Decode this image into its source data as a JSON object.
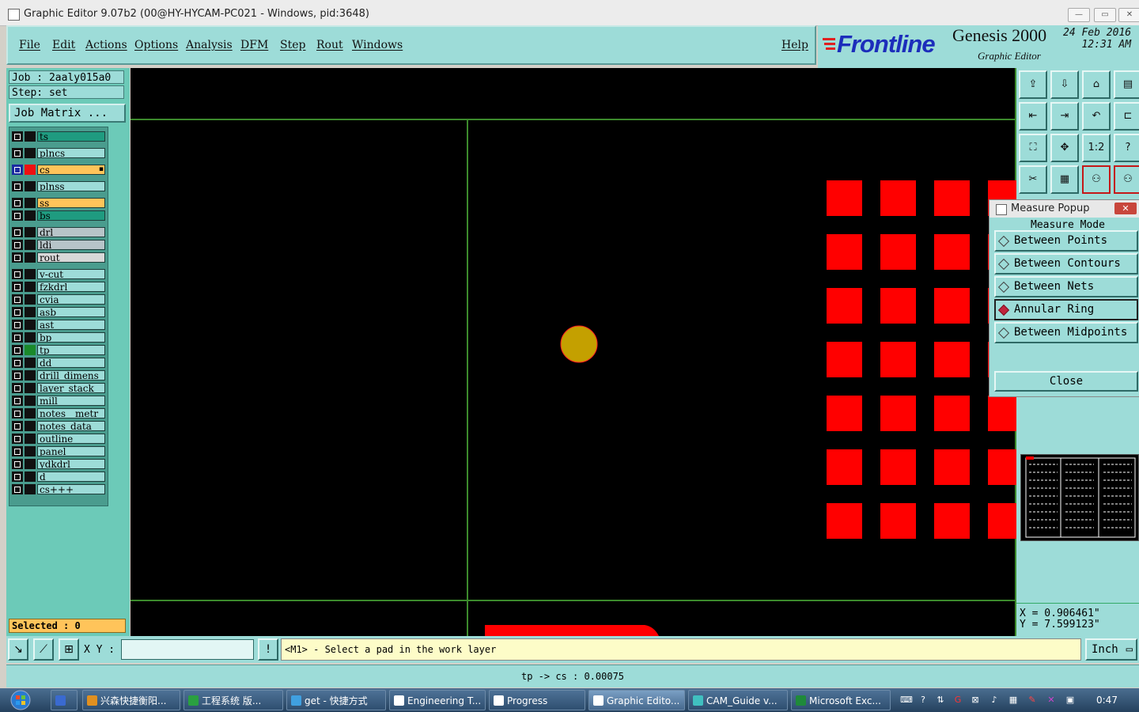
{
  "window": {
    "title": "Graphic Editor 9.07b2 (00@HY-HYCAM-PC021 - Windows, pid:3648)",
    "minimize": "—",
    "maximize": "▭",
    "close": "✕"
  },
  "menu": {
    "items": [
      "File",
      "Edit",
      "Actions",
      "Options",
      "Analysis",
      "DFM",
      "Step",
      "Rout",
      "Windows"
    ],
    "help": "Help"
  },
  "branding": {
    "logo": "Frontline",
    "product": "Genesis 2000",
    "subtitle": "Graphic Editor",
    "date": "24 Feb 2016",
    "time": "12:31 AM"
  },
  "job": {
    "job_label": "Job : 2aaly015a0",
    "step_label": "Step: set",
    "job_matrix": "Job Matrix ..."
  },
  "layers": [
    {
      "name": "ts",
      "bg": "#1f9b80",
      "color": "#111"
    },
    {
      "name": "plncs",
      "bg": "#9ddcd8",
      "color": "#111"
    },
    {
      "name": "cs",
      "bg": "#ffc45a",
      "color": "#e11",
      "work": true,
      "marker": "▪"
    },
    {
      "name": "plnss",
      "bg": "#9ddcd8",
      "color": "#111"
    },
    {
      "name": "ss",
      "bg": "#ffc45a",
      "color": "#111"
    },
    {
      "name": "bs",
      "bg": "#1f9b80",
      "color": "#111"
    },
    {
      "name": "drl",
      "bg": "#b7c4c8",
      "color": "#111"
    },
    {
      "name": "ldi",
      "bg": "#b7c4c8",
      "color": "#111"
    },
    {
      "name": "rout",
      "bg": "#d8d8d8",
      "color": "#111"
    },
    {
      "name": "v-cut",
      "bg": "#9ddcd8",
      "color": "#111"
    },
    {
      "name": "fzkdrl",
      "bg": "#9ddcd8",
      "color": "#111"
    },
    {
      "name": "cvia",
      "bg": "#9ddcd8",
      "color": "#111"
    },
    {
      "name": "asb",
      "bg": "#9ddcd8",
      "color": "#111"
    },
    {
      "name": "ast",
      "bg": "#9ddcd8",
      "color": "#111"
    },
    {
      "name": "bp",
      "bg": "#9ddcd8",
      "color": "#111"
    },
    {
      "name": "tp",
      "bg": "#9ddcd8",
      "color": "#1a8a2a"
    },
    {
      "name": "dd",
      "bg": "#9ddcd8",
      "color": "#111"
    },
    {
      "name": "drill_dimens",
      "bg": "#9ddcd8",
      "color": "#111"
    },
    {
      "name": "layer_stack",
      "bg": "#9ddcd8",
      "color": "#111"
    },
    {
      "name": "mill",
      "bg": "#9ddcd8",
      "color": "#111"
    },
    {
      "name": "notes__metr",
      "bg": "#9ddcd8",
      "color": "#111"
    },
    {
      "name": "notes_data_",
      "bg": "#9ddcd8",
      "color": "#111"
    },
    {
      "name": "outline",
      "bg": "#9ddcd8",
      "color": "#111"
    },
    {
      "name": "panel",
      "bg": "#9ddcd8",
      "color": "#111"
    },
    {
      "name": "ydkdrl",
      "bg": "#9ddcd8",
      "color": "#111"
    },
    {
      "name": "d",
      "bg": "#9ddcd8",
      "color": "#111"
    },
    {
      "name": "cs+++",
      "bg": "#9ddcd8",
      "color": "#111"
    }
  ],
  "selected": "Selected : 0",
  "colors": {
    "pad": "#ff0000",
    "tp_pad": "#c4a000",
    "grid": "#3c8a2c",
    "canvas": "#000000",
    "panel": "#9ddcd8"
  },
  "tools": {
    "icons": [
      "export-icon",
      "import-icon",
      "home-icon",
      "layout-icon",
      "prev-icon",
      "next-icon",
      "undo-icon",
      "snap-icon",
      "fit-icon",
      "center-icon",
      "scale-icon",
      "help-icon",
      "cut-icon",
      "grid-icon",
      "net-icon",
      "net2-icon"
    ],
    "scale_label": "1:2",
    "help_label": "?"
  },
  "measure": {
    "title": "Measure Popup",
    "close_x": "✕",
    "mode_label": "Measure Mode",
    "options": [
      "Between Points",
      "Between Contours",
      "Between Nets",
      "Annular Ring",
      "Between Midpoints"
    ],
    "selected_index": 3,
    "close_button": "Close"
  },
  "coords": {
    "x": "X = 0.906461\"",
    "y": "Y = 7.599123\""
  },
  "command": {
    "xy_label": "X Y :",
    "xy_value": "",
    "alert": "!",
    "prompt": "<M1> - Select a pad in the work layer",
    "unit": "Inch"
  },
  "status": "tp -> cs : 0.00075",
  "taskbar": {
    "tasks": [
      {
        "label": "兴森快捷衡阳...",
        "icon": "app-icon",
        "color": "#e09020"
      },
      {
        "label": "工程系统  版...",
        "icon": "p-icon",
        "color": "#2aa040"
      },
      {
        "label": "get - 快捷方式",
        "icon": "shortcut-icon",
        "color": "#40a0e0"
      },
      {
        "label": "Engineering T...",
        "icon": "genesis-icon",
        "color": "#ffffff"
      },
      {
        "label": "Progress",
        "icon": "genesis-icon",
        "color": "#ffffff"
      },
      {
        "label": "Graphic Edito...",
        "icon": "genesis-icon",
        "color": "#ffffff",
        "active": true
      },
      {
        "label": "CAM_Guide v...",
        "icon": "cam-icon",
        "color": "#40c0c0"
      },
      {
        "label": "Microsoft Exc...",
        "icon": "excel-icon",
        "color": "#1f8a3a"
      }
    ],
    "clock": "0:47"
  }
}
